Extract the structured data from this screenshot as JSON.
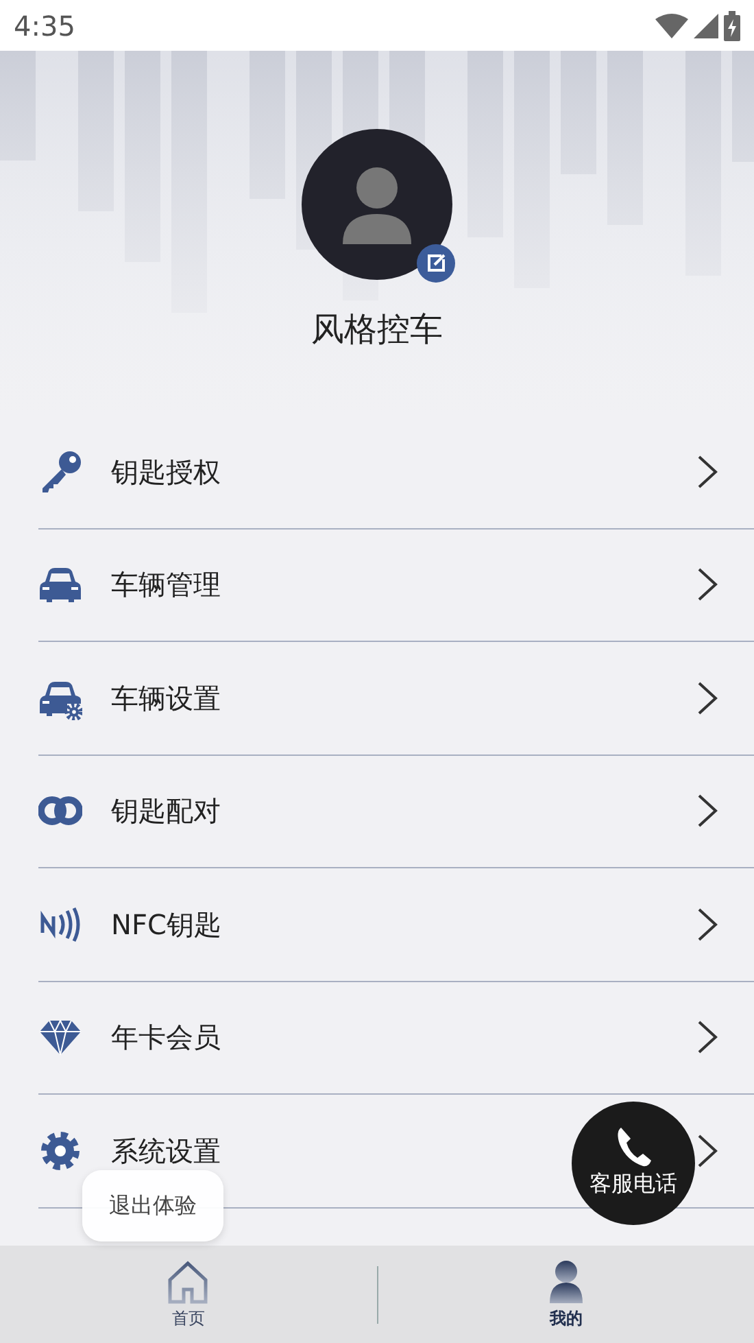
{
  "status_bar": {
    "time": "4:35"
  },
  "profile": {
    "name": "风格控车"
  },
  "menu": [
    {
      "label": "钥匙授权"
    },
    {
      "label": "车辆管理"
    },
    {
      "label": "车辆设置"
    },
    {
      "label": "钥匙配对"
    },
    {
      "label": "NFC钥匙"
    },
    {
      "label": "年卡会员"
    },
    {
      "label": "系统设置"
    }
  ],
  "toast": {
    "text": "退出体验"
  },
  "call_button": {
    "label": "客服电话"
  },
  "tab_bar": [
    {
      "label": "首页",
      "selected": false
    },
    {
      "label": "我的",
      "selected": true
    }
  ]
}
